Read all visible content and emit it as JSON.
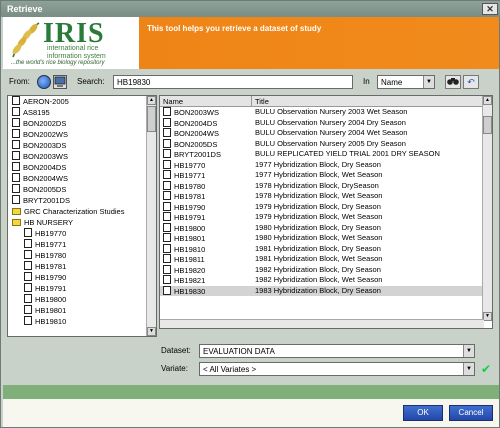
{
  "window": {
    "title": "Retrieve",
    "close_label": "✕"
  },
  "header": {
    "logo": {
      "name": "IRIS",
      "line1": "international rice",
      "line2": "information system",
      "tagline": "...the world's rice biology repository"
    },
    "banner_text": "This tool helps you retrieve a dataset of study"
  },
  "toolbar": {
    "from_label": "From:",
    "search_label": "Search:",
    "search_value": "HB19830",
    "in_label": "In",
    "in_value": "Name"
  },
  "tree": {
    "items": [
      {
        "label": "AERON-2005",
        "kind": "doc",
        "indent": 0
      },
      {
        "label": "AS8195",
        "kind": "doc",
        "indent": 0
      },
      {
        "label": "BON2002DS",
        "kind": "doc",
        "indent": 0
      },
      {
        "label": "BON2002WS",
        "kind": "doc",
        "indent": 0
      },
      {
        "label": "BON2003DS",
        "kind": "doc",
        "indent": 0
      },
      {
        "label": "BON2003WS",
        "kind": "doc",
        "indent": 0
      },
      {
        "label": "BON2004DS",
        "kind": "doc",
        "indent": 0
      },
      {
        "label": "BON2004WS",
        "kind": "doc",
        "indent": 0
      },
      {
        "label": "BON2005DS",
        "kind": "doc",
        "indent": 0
      },
      {
        "label": "BRYT2001DS",
        "kind": "doc",
        "indent": 0
      },
      {
        "label": "GRC Characterization Studies",
        "kind": "folder",
        "indent": 0
      },
      {
        "label": "HB NURSERY",
        "kind": "folder",
        "indent": 0
      },
      {
        "label": "HB19770",
        "kind": "doc",
        "indent": 1
      },
      {
        "label": "HB19771",
        "kind": "doc",
        "indent": 1
      },
      {
        "label": "HB19780",
        "kind": "doc",
        "indent": 1
      },
      {
        "label": "HB19781",
        "kind": "doc",
        "indent": 1
      },
      {
        "label": "HB19790",
        "kind": "doc",
        "indent": 1
      },
      {
        "label": "HB19791",
        "kind": "doc",
        "indent": 1
      },
      {
        "label": "HB19800",
        "kind": "doc",
        "indent": 1
      },
      {
        "label": "HB19801",
        "kind": "doc",
        "indent": 1
      },
      {
        "label": "HB19810",
        "kind": "doc",
        "indent": 1
      }
    ]
  },
  "table": {
    "columns": [
      "Name",
      "Title"
    ],
    "rows": [
      {
        "name": "BON2003WS",
        "title": "BULU Observation Nursery 2003 Wet Season"
      },
      {
        "name": "BON2004DS",
        "title": "BULU Observation Nursery 2004 Dry Season"
      },
      {
        "name": "BON2004WS",
        "title": "BULU Observation Nursery 2004 Wet Season"
      },
      {
        "name": "BON2005DS",
        "title": "BULU Observation Nursery 2005 Dry Season"
      },
      {
        "name": "BRYT2001DS",
        "title": "BULU REPLICATED YIELD TRIAL 2001 DRY SEASON"
      },
      {
        "name": "HB19770",
        "title": "1977 Hybridization Block, Dry Season"
      },
      {
        "name": "HB19771",
        "title": "1977 Hybridization Block,  Wet Season"
      },
      {
        "name": "HB19780",
        "title": "1978 Hybridization Block, DrySeason"
      },
      {
        "name": "HB19781",
        "title": "1978 Hybridization Block, Wet Season"
      },
      {
        "name": "HB19790",
        "title": "1979 Hybridization Block,  Dry Season"
      },
      {
        "name": "HB19791",
        "title": "1979 Hybridization Block, Wet Season"
      },
      {
        "name": "HB19800",
        "title": "1980 Hybridization Block, Dry Season"
      },
      {
        "name": "HB19801",
        "title": "1980 Hybridization Block,  Wet Season"
      },
      {
        "name": "HB19810",
        "title": "1981 Hybridization Block, Dry  Season"
      },
      {
        "name": "HB19811",
        "title": "1981 Hybridization Block, Wet Season"
      },
      {
        "name": "HB19820",
        "title": "1982 Hybridization Block, Dry Season"
      },
      {
        "name": "HB19821",
        "title": "1982 Hybridization Block,  Wet Season"
      },
      {
        "name": "HB19830",
        "title": "1983 Hybridization Block,  Dry Season"
      }
    ],
    "selected_row": "HB19830"
  },
  "fields": {
    "dataset_label": "Dataset:",
    "dataset_value": "EVALUATION DATA",
    "variate_label": "Variate:",
    "variate_value": "< All Variates >"
  },
  "footer": {
    "ok_label": "OK",
    "cancel_label": "Cancel"
  },
  "colors": {
    "banner": "#ef8416",
    "logo_green": "#2a7a3a",
    "button_blue": "#2447a8",
    "stripe_green": "#7fb07a"
  }
}
